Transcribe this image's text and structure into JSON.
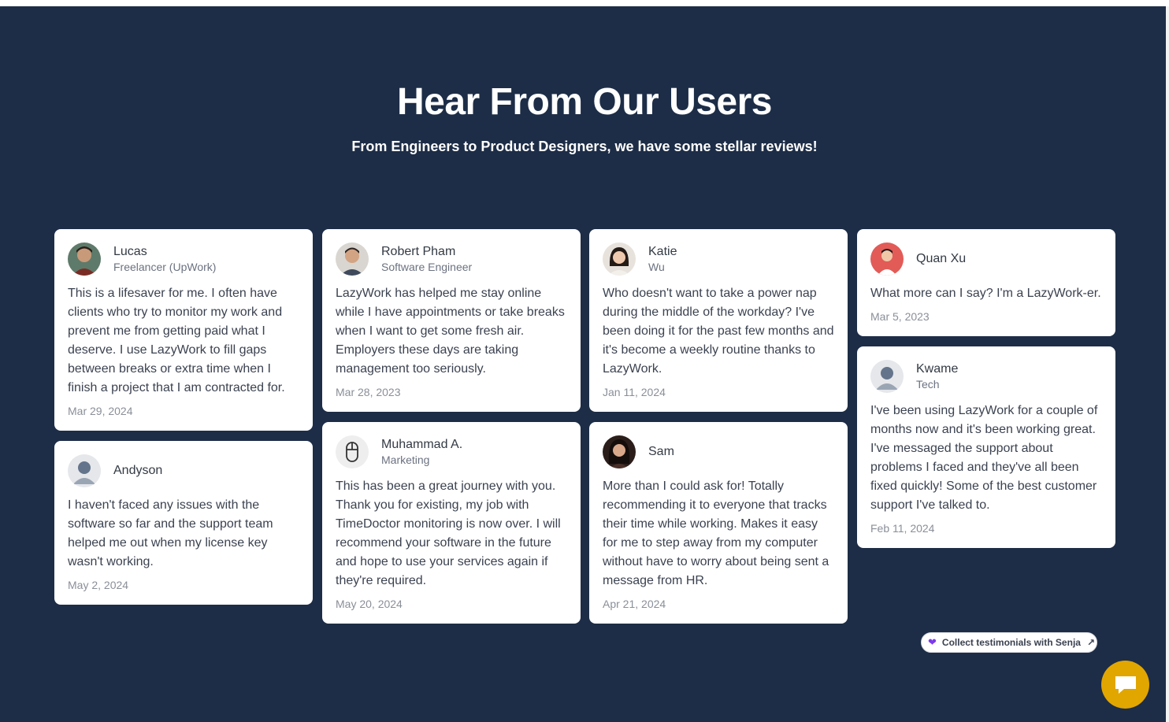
{
  "header": {
    "title": "Hear From Our Users",
    "subtitle": "From Engineers to Product Designers, we have some stellar reviews!"
  },
  "testimonials": [
    {
      "name": "Lucas",
      "role": "Freelancer (UpWork)",
      "text": "This is a lifesaver for me. I often have clients who try to monitor my work and prevent me from getting paid what I deserve. I use LazyWork to fill gaps between breaks or extra time when I finish a project that I am contracted for.",
      "date": "Mar 29, 2024"
    },
    {
      "name": "Andyson",
      "role": "",
      "text": "I haven't faced any issues with the software so far and the support team helped me out when my license key wasn't working.",
      "date": "May 2, 2024"
    },
    {
      "name": "Robert Pham",
      "role": "Software Engineer",
      "text": "LazyWork has helped me stay online while I have appointments or take breaks when I want to get some fresh air. Employers these days are taking management too seriously.",
      "date": "Mar 28, 2023"
    },
    {
      "name": "Muhammad A.",
      "role": "Marketing",
      "text": "This has been a great journey with you. Thank you for existing, my job with TimeDoctor monitoring is now over. I will recommend your software in the future and hope to use your services again if they're required.",
      "date": "May 20, 2024"
    },
    {
      "name": "Katie",
      "role": "Wu",
      "text": "Who doesn't want to take a power nap during the middle of the workday? I've been doing it for the past few months and it's become a weekly routine thanks to LazyWork.",
      "date": "Jan 11, 2024"
    },
    {
      "name": "Sam",
      "role": "",
      "text": "More than I could ask for! Totally recommending it to everyone that tracks their time while working. Makes it easy for me to step away from my computer without have to worry about being sent a message from HR.",
      "date": "Apr 21, 2024"
    },
    {
      "name": "Quan Xu",
      "role": "",
      "text": "What more can I say? I'm a LazyWork-er.",
      "date": "Mar 5, 2023"
    },
    {
      "name": "Kwame",
      "role": "Tech",
      "text": "I've been using LazyWork for a couple of months now and it's been working great. I've messaged the support about problems I faced and they've all been fixed quickly! Some of the best customer support I've talked to.",
      "date": "Feb 11, 2024"
    }
  ],
  "senja_badge": {
    "label": "Collect testimonials with Senja"
  },
  "colors": {
    "background": "#1d2d47",
    "card": "#ffffff",
    "chat_button": "#e2a600",
    "heart": "#7c3aed"
  }
}
